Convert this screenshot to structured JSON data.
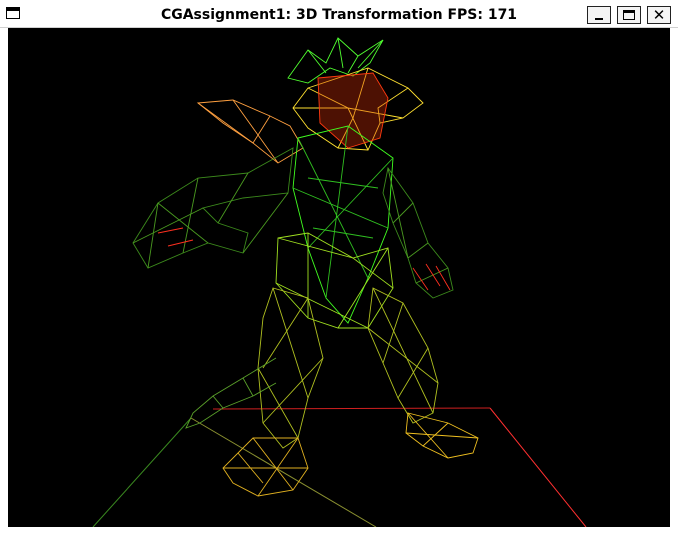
{
  "window": {
    "title": "CGAssignment1: 3D Transformation FPS: 171"
  },
  "controls": {
    "minimize_icon": "minimize-icon",
    "maximize_icon": "maximize-icon",
    "close_glyph": "✕"
  },
  "scene": {
    "background": "#000000",
    "model_colors": [
      "#ff3a10",
      "#ffe020",
      "#40ff20",
      "#ffa040",
      "#3c8a1c"
    ],
    "floor_colors": [
      "#ff2020",
      "#40a020",
      "#c0c040"
    ]
  }
}
